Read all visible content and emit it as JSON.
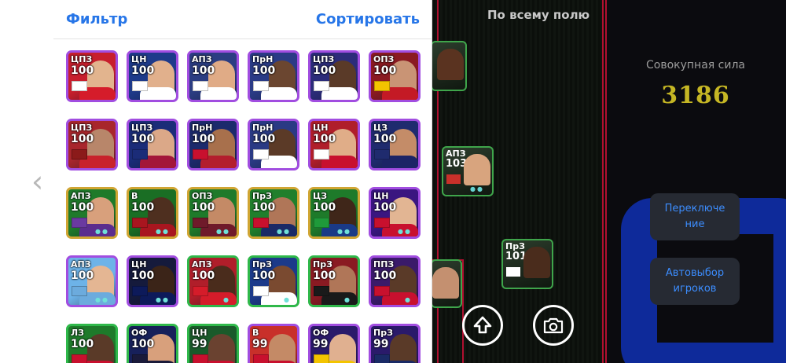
{
  "sheet": {
    "filter_label": "Фильтр",
    "sort_label": "Сортировать"
  },
  "pitch": {
    "mode_label": "По всему полю"
  },
  "stats": {
    "total_power_label": "Совокупная сила",
    "total_power_value": "3186"
  },
  "actions": {
    "switch_label": "Переключение",
    "auto_select_label": "Автовыбор игроков"
  },
  "icons": {
    "back": "chevron-left-icon",
    "upload": "arrow-up-icon",
    "camera": "camera-icon"
  },
  "colors": {
    "accent_blue": "#2776e8",
    "power_gold": "#c5b624",
    "pitch_line": "#b01030"
  },
  "field_players": [
    {
      "position": "АПЗ",
      "rating": "103",
      "dots": "●●"
    },
    {
      "position": "ПрЗ",
      "rating": "101",
      "dots": "●●"
    }
  ],
  "players": [
    {
      "position": "ЦПЗ",
      "rating": "100",
      "border": "#a14de0",
      "bg": "#c71f2d",
      "face": "#e2b48e",
      "shirt": "#d51c2a",
      "flag": "#ffffff",
      "dots": ""
    },
    {
      "position": "ЦН",
      "rating": "100",
      "border": "#a14de0",
      "bg": "#1e3a8a",
      "face": "#e1b08c",
      "shirt": "#ffffff",
      "flag": "#ffffff",
      "dots": ""
    },
    {
      "position": "АПЗ",
      "rating": "100",
      "border": "#a14de0",
      "bg": "#2b3d82",
      "face": "#e0ab86",
      "shirt": "#ffffff",
      "flag": "#ffffff",
      "dots": ""
    },
    {
      "position": "ПрН",
      "rating": "100",
      "border": "#a14de0",
      "bg": "#2a3b86",
      "face": "#6b4630",
      "shirt": "#ffffff",
      "flag": "#ffffff",
      "dots": ""
    },
    {
      "position": "ЦПЗ",
      "rating": "100",
      "border": "#a14de0",
      "bg": "#2c2c7a",
      "face": "#5a3a28",
      "shirt": "#ffffff",
      "flag": "#ffffff",
      "dots": ""
    },
    {
      "position": "ОПЗ",
      "rating": "100",
      "border": "#a14de0",
      "bg": "#8a1a22",
      "face": "#c99475",
      "shirt": "#c41a25",
      "flag": "#f3c400",
      "dots": ""
    },
    {
      "position": "ЦПЗ",
      "rating": "100",
      "border": "#a14de0",
      "bg": "#a8262c",
      "face": "#b8866a",
      "shirt": "#c8222b",
      "flag": "#8b1a1a",
      "dots": ""
    },
    {
      "position": "ЦПЗ",
      "rating": "100",
      "border": "#a14de0",
      "bg": "#1b2c78",
      "face": "#dba888",
      "shirt": "#a3163a",
      "flag": "#1b2c78",
      "dots": ""
    },
    {
      "position": "ПрН",
      "rating": "100",
      "border": "#a14de0",
      "bg": "#1c2a6c",
      "face": "#a8704c",
      "shirt": "#b31e2d",
      "flag": "#c8102e",
      "dots": ""
    },
    {
      "position": "ПрН",
      "rating": "100",
      "border": "#a14de0",
      "bg": "#2a3a84",
      "face": "#5b3a27",
      "shirt": "#ffffff",
      "flag": "#ffffff",
      "dots": ""
    },
    {
      "position": "ЦН",
      "rating": "100",
      "border": "#a14de0",
      "bg": "#b01e2a",
      "face": "#e0ad88",
      "shirt": "#c8102e",
      "flag": "#ffffff",
      "dots": ""
    },
    {
      "position": "ЦЗ",
      "rating": "100",
      "border": "#a14de0",
      "bg": "#1f2b6e",
      "face": "#c48c68",
      "shirt": "#1c2466",
      "flag": "#1f2b6e",
      "dots": ""
    },
    {
      "position": "АПЗ",
      "rating": "100",
      "border": "#d0a533",
      "bg": "#1f7a2a",
      "face": "#d8a07c",
      "shirt": "#5b2d8e",
      "flag": "#6a3aa0",
      "dots": "●●"
    },
    {
      "position": "В",
      "rating": "100",
      "border": "#d0a533",
      "bg": "#1a6e24",
      "face": "#4e2f1f",
      "shirt": "#a8161f",
      "flag": "#a8161f",
      "dots": "●●"
    },
    {
      "position": "ОПЗ",
      "rating": "100",
      "border": "#d0a533",
      "bg": "#1e7a2a",
      "face": "#c48a66",
      "shirt": "#6f1a2a",
      "flag": "#6f1a2a",
      "dots": "●●"
    },
    {
      "position": "ПрЗ",
      "rating": "100",
      "border": "#d0a533",
      "bg": "#207f2c",
      "face": "#b07658",
      "shirt": "#1a2a66",
      "flag": "#c8102e",
      "dots": "●●"
    },
    {
      "position": "ЦЗ",
      "rating": "100",
      "border": "#d0a533",
      "bg": "#1e7a2a",
      "face": "#3f2619",
      "shirt": "#1a3a86",
      "flag": "#1f9a3a",
      "dots": "●●"
    },
    {
      "position": "ЦН",
      "rating": "100",
      "border": "#a14de0",
      "bg": "#3a1680",
      "face": "#e2b593",
      "shirt": "#c8102e",
      "flag": "#c8102e",
      "dots": "●●"
    },
    {
      "position": "АПЗ",
      "rating": "100",
      "border": "#a14de0",
      "bg": "#6db3e8",
      "face": "#e4b693",
      "shirt": "#6cabdd",
      "flag": "#6cabdd",
      "dots": "●●"
    },
    {
      "position": "ЦН",
      "rating": "100",
      "border": "#a14de0",
      "bg": "#151a3c",
      "face": "#3b2418",
      "shirt": "#0d1a5a",
      "flag": "#0d1a5a",
      "dots": "●●"
    },
    {
      "position": "АПЗ",
      "rating": "100",
      "border": "#2fb84a",
      "bg": "#b01e2a",
      "face": "#4a2c1c",
      "shirt": "#d51c2a",
      "flag": "#d51c2a",
      "dots": "●"
    },
    {
      "position": "ПрЗ",
      "rating": "100",
      "border": "#2fb84a",
      "bg": "#1c3a8a",
      "face": "#7a4a30",
      "shirt": "#ffffff",
      "flag": "#ffffff",
      "dots": "●"
    },
    {
      "position": "ПрЗ",
      "rating": "100",
      "border": "#2fb84a",
      "bg": "#8a1a22",
      "face": "#b07658",
      "shirt": "#1a1a1a",
      "flag": "#1a1a1a",
      "dots": "●"
    },
    {
      "position": "ППЗ",
      "rating": "100",
      "border": "#a14de0",
      "bg": "#3a1a6a",
      "face": "#5a3a28",
      "shirt": "#c8102e",
      "flag": "#c8102e",
      "dots": "●"
    },
    {
      "position": "ЛЗ",
      "rating": "100",
      "border": "#2fb84a",
      "bg": "#1e7a2a",
      "face": "#5a3a28",
      "shirt": "#c8102e",
      "flag": "#c8102e",
      "dots": ""
    },
    {
      "position": "ОФ",
      "rating": "100",
      "border": "#2fb84a",
      "bg": "#17205a",
      "face": "#d8a07c",
      "shirt": "#1a1a3a",
      "flag": "#1a1a3a",
      "dots": ""
    },
    {
      "position": "ЦН",
      "rating": "99",
      "border": "#2fb84a",
      "bg": "#1a5a2a",
      "face": "#6a4230",
      "shirt": "#c8102e",
      "flag": "#c8102e",
      "dots": ""
    },
    {
      "position": "В",
      "rating": "99",
      "border": "#a14de0",
      "bg": "#c8302a",
      "face": "#c48a66",
      "shirt": "#c8102e",
      "flag": "#c8102e",
      "dots": ""
    },
    {
      "position": "ОФ",
      "rating": "99",
      "border": "#a14de0",
      "bg": "#2a1a6a",
      "face": "#e0b090",
      "shirt": "#f3c400",
      "flag": "#f3c400",
      "dots": ""
    },
    {
      "position": "ПрЗ",
      "rating": "99",
      "border": "#a14de0",
      "bg": "#2a1a6a",
      "face": "#5a3a28",
      "shirt": "#1a2a66",
      "flag": "#1a2a66",
      "dots": ""
    }
  ]
}
